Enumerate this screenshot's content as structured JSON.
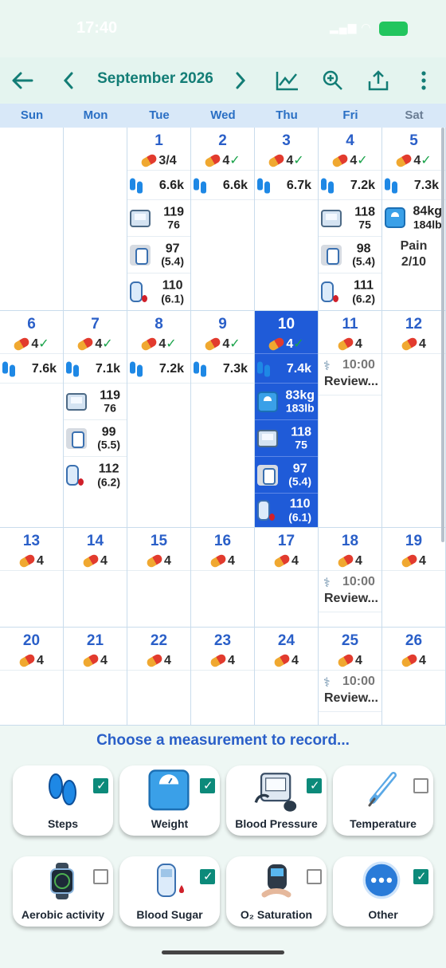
{
  "status": {
    "time": "17:40",
    "signal": "Wi-Fi"
  },
  "toolbar": {
    "month": "September 2026"
  },
  "weekdays": [
    "Sun",
    "Mon",
    "Tue",
    "Wed",
    "Thu",
    "Fri",
    "Sat"
  ],
  "week1": {
    "tue": {
      "day": "1",
      "meds": "3/4",
      "steps": "6.6k",
      "bp_sys": "119",
      "bp_dia": "76",
      "meter": "97",
      "meter_mmol": "(5.4)",
      "sugar": "110",
      "sugar_mmol": "(6.1)"
    },
    "wed": {
      "day": "2",
      "meds": "4",
      "steps": "6.6k"
    },
    "thu": {
      "day": "3",
      "meds": "4",
      "steps": "6.7k"
    },
    "fri": {
      "day": "4",
      "meds": "4",
      "steps": "7.2k",
      "bp_sys": "118",
      "bp_dia": "75",
      "meter": "98",
      "meter_mmol": "(5.4)",
      "sugar": "111",
      "sugar_mmol": "(6.2)"
    },
    "sat": {
      "day": "5",
      "meds": "4",
      "steps": "7.3k",
      "weight_kg": "84kg",
      "weight_lb": "184lb",
      "note": "Pain",
      "note_val": "2/10"
    }
  },
  "week2": {
    "sun": {
      "day": "6",
      "meds": "4",
      "steps": "7.6k"
    },
    "mon": {
      "day": "7",
      "meds": "4",
      "steps": "7.1k",
      "bp_sys": "119",
      "bp_dia": "76",
      "meter": "99",
      "meter_mmol": "(5.5)",
      "sugar": "112",
      "sugar_mmol": "(6.2)"
    },
    "tue": {
      "day": "8",
      "meds": "4",
      "steps": "7.2k"
    },
    "wed": {
      "day": "9",
      "meds": "4",
      "steps": "7.3k"
    },
    "thu": {
      "day": "10",
      "meds": "4",
      "steps": "7.4k",
      "weight_kg": "83kg",
      "weight_lb": "183lb",
      "bp_sys": "118",
      "bp_dia": "75",
      "meter": "97",
      "meter_mmol": "(5.4)",
      "sugar": "110",
      "sugar_mmol": "(6.1)"
    },
    "fri": {
      "day": "11",
      "meds": "4",
      "appt_time": "10:00",
      "appt_title": "Review..."
    },
    "sat": {
      "day": "12",
      "meds": "4"
    }
  },
  "week3": {
    "sun": {
      "day": "13",
      "meds": "4"
    },
    "mon": {
      "day": "14",
      "meds": "4"
    },
    "tue": {
      "day": "15",
      "meds": "4"
    },
    "wed": {
      "day": "16",
      "meds": "4"
    },
    "thu": {
      "day": "17",
      "meds": "4"
    },
    "fri": {
      "day": "18",
      "meds": "4",
      "appt_time": "10:00",
      "appt_title": "Review..."
    },
    "sat": {
      "day": "19",
      "meds": "4"
    }
  },
  "week4": {
    "sun": {
      "day": "20",
      "meds": "4"
    },
    "mon": {
      "day": "21",
      "meds": "4"
    },
    "tue": {
      "day": "22",
      "meds": "4"
    },
    "wed": {
      "day": "23",
      "meds": "4"
    },
    "thu": {
      "day": "24",
      "meds": "4"
    },
    "fri": {
      "day": "25",
      "meds": "4",
      "appt_time": "10:00",
      "appt_title": "Review..."
    },
    "sat": {
      "day": "26",
      "meds": "4"
    }
  },
  "chooser": {
    "prompt": "Choose a measurement to record...",
    "tiles": [
      {
        "label": "Steps",
        "checked": true
      },
      {
        "label": "Weight",
        "checked": true
      },
      {
        "label": "Blood Pressure",
        "checked": true
      },
      {
        "label": "Temperature",
        "checked": false
      },
      {
        "label": "Aerobic activity",
        "checked": false
      },
      {
        "label": "Blood Sugar",
        "checked": true
      },
      {
        "label": "O₂ Saturation",
        "checked": false
      },
      {
        "label": "Other",
        "checked": true
      }
    ]
  },
  "colors": {
    "accent": "#137d76",
    "today": "#1f5bd8",
    "daynum": "#2a5fc8",
    "check": "#0c8a7a"
  }
}
